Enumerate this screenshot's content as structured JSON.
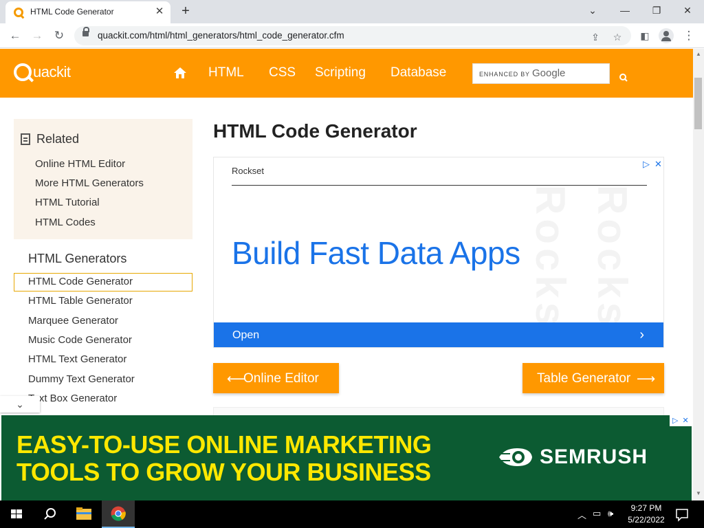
{
  "browser": {
    "tab_title": "HTML Code Generator",
    "tab_close": "✕",
    "new_tab": "+",
    "url": "quackit.com/html/html_generators/html_code_generator.cfm",
    "window_controls": {
      "minimize": "—",
      "restore": "❐",
      "close": "✕",
      "tabsearch": "⌄"
    }
  },
  "site": {
    "logo_text": "uackit",
    "nav": [
      "HTML",
      "CSS",
      "Scripting",
      "Database"
    ],
    "search_enhanced": "ENHANCED BY",
    "search_brand": "Google"
  },
  "sidebar": {
    "related_title": "Related",
    "related_links": [
      "Online HTML Editor",
      "More HTML Generators",
      "HTML Tutorial",
      "HTML Codes"
    ],
    "generators_title": "HTML Generators",
    "generator_links": [
      "HTML Code Generator",
      "HTML Table Generator",
      "Marquee Generator",
      "Music Code Generator",
      "HTML Text Generator",
      "Dummy Text Generator",
      "Text Box Generator"
    ]
  },
  "main": {
    "title": "HTML Code Generator",
    "ad": {
      "advertiser": "Rockset",
      "headline": "Build Fast Data Apps",
      "watermark": "Rockset",
      "cta": "Open"
    },
    "prev_button": "Online Editor",
    "next_button": "Table Generator"
  },
  "bottom_ad": {
    "line1": "EASY-TO-USE ONLINE MARKETING",
    "line2": "TOOLS TO GROW YOUR BUSINESS",
    "brand": "SEMRUSH"
  },
  "taskbar": {
    "time": "9:27 PM",
    "date": "5/22/2022"
  },
  "colors": {
    "quackit_orange": "#ff9800",
    "ad_blue": "#1a73e8",
    "semrush_green": "#0c5b32",
    "semrush_yellow": "#ffe800"
  }
}
